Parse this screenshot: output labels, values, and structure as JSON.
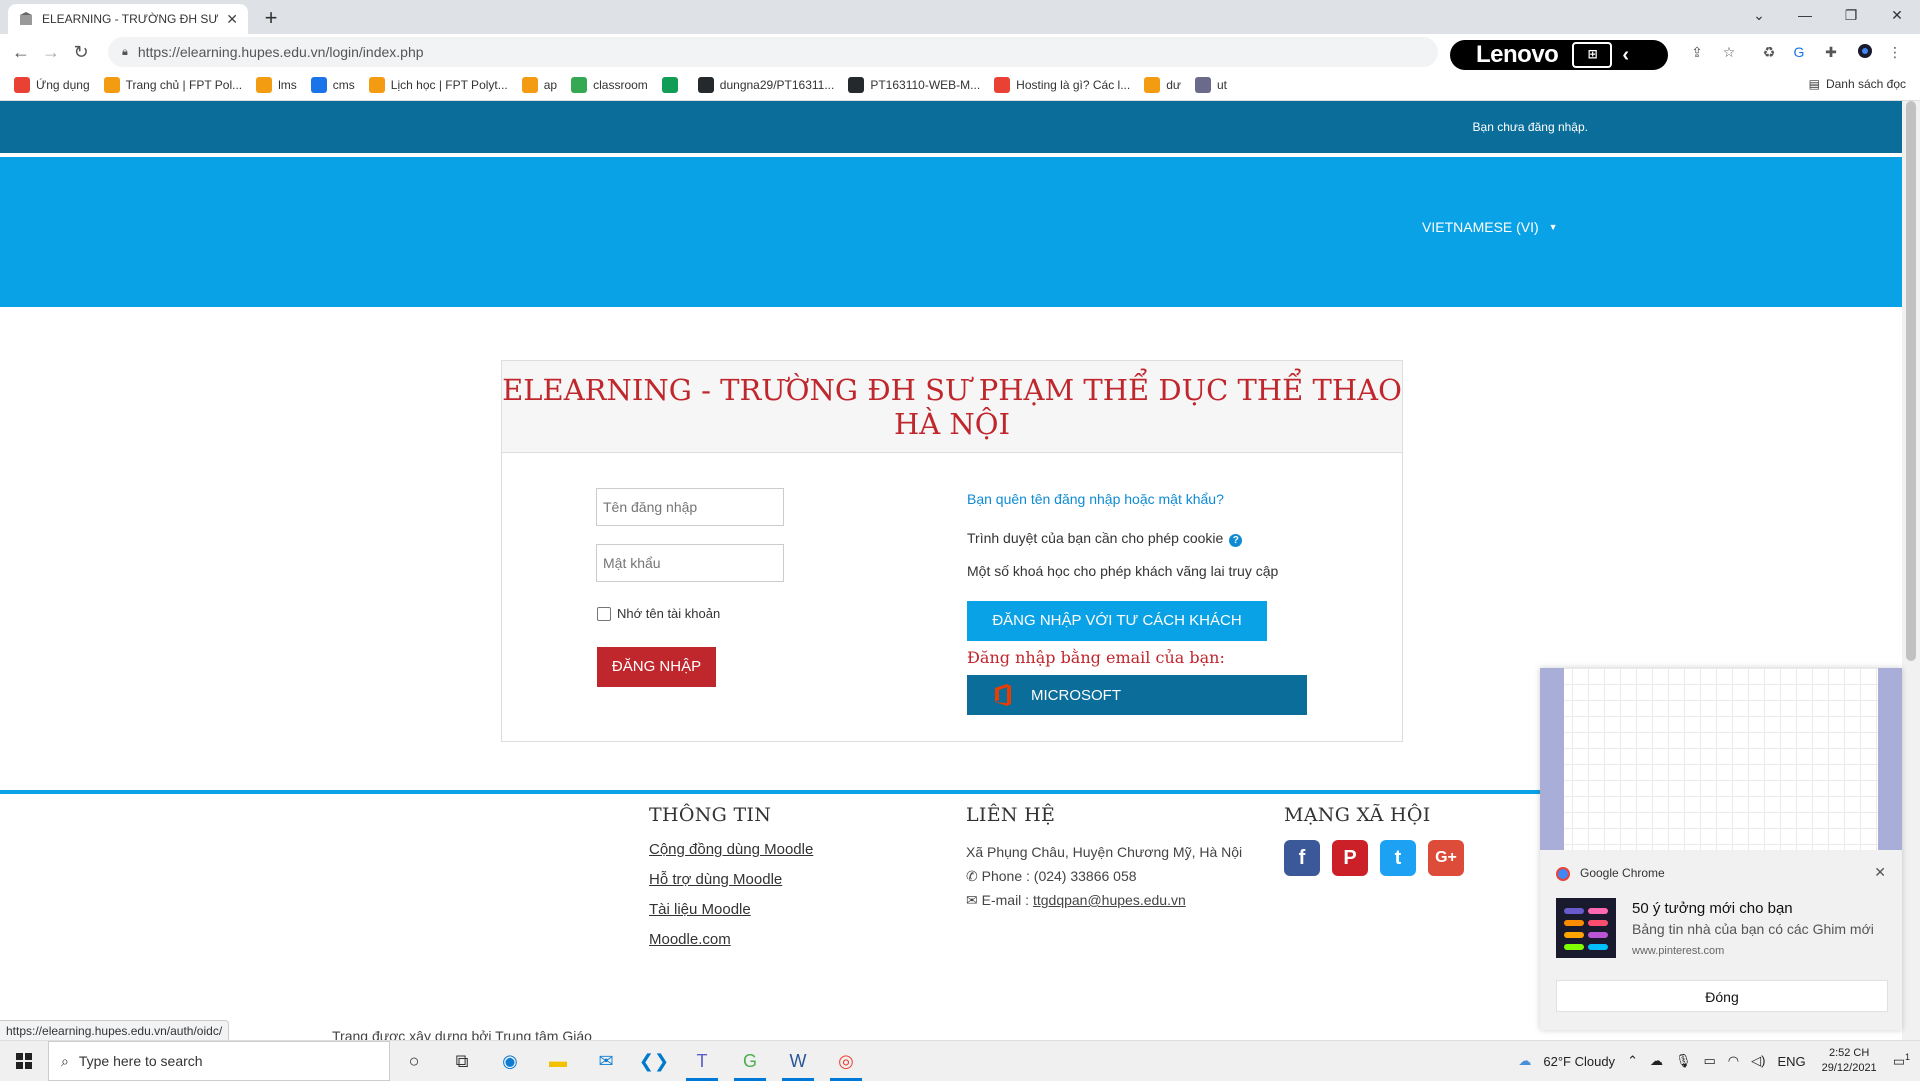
{
  "browser": {
    "tab_title": "ELEARNING - TRƯỜNG ĐH SƯ PHẠM",
    "url": "https://elearning.hupes.edu.vn/login/index.php",
    "lenovo_label": "Lenovo",
    "bookmarks": [
      {
        "label": "Ứng dụng",
        "color": "#e94235"
      },
      {
        "label": "Trang chủ | FPT Pol...",
        "color": "#f39c12"
      },
      {
        "label": "lms",
        "color": "#f39c12"
      },
      {
        "label": "cms",
        "color": "#1a73e8"
      },
      {
        "label": "Lịch học | FPT Polyt...",
        "color": "#f39c12"
      },
      {
        "label": "ap",
        "color": "#f39c12"
      },
      {
        "label": "classroom",
        "color": "#34a853"
      },
      {
        "label": "",
        "color": "#0f9d58"
      },
      {
        "label": "dungna29/PT16311...",
        "color": "#24292e"
      },
      {
        "label": "PT163110-WEB-M...",
        "color": "#24292e"
      },
      {
        "label": "Hosting là gì? Các l...",
        "color": "#e94235"
      },
      {
        "label": "dư",
        "color": "#f39c12"
      },
      {
        "label": "ut",
        "color": "#6a6a8a"
      }
    ],
    "reading_list": "Danh sách đọc",
    "status_url": "https://elearning.hupes.edu.vn/auth/oidc/"
  },
  "page": {
    "login_status": "Bạn chưa đăng nhập.",
    "language": "VIETNAMESE (VI)",
    "site_title_line1": "ELEARNING - TRƯỜNG ĐH SƯ PHẠM THỂ DỤC THỂ THAO",
    "site_title_line2": "HÀ NỘI",
    "login": {
      "username_placeholder": "Tên đăng nhập",
      "password_placeholder": "Mật khẩu",
      "remember_label": "Nhớ tên tài khoản",
      "login_button": "ĐĂNG NHẬP",
      "forgot_link": "Bạn quên tên đăng nhập hoặc mật khẩu?",
      "cookie_text": "Trình duyệt của bạn cần cho phép cookie",
      "guest_text": "Một số khoá học cho phép khách vãng lai truy cập",
      "guest_button": "ĐĂNG NHẬP VỚI TƯ CÁCH KHÁCH",
      "email_login_text": "Đăng nhập bằng email của bạn:",
      "microsoft_button": "MICROSOFT"
    },
    "footer": {
      "info_heading": "THÔNG TIN",
      "info_links": [
        "Cộng đồng dùng Moodle",
        "Hỗ trợ dùng Moodle",
        "Tài liệu Moodle",
        "Moodle.com"
      ],
      "contact_heading": "LIÊN HỆ",
      "address": "Xã Phụng Châu, Huyện Chương Mỹ, Hà Nội",
      "phone": "Phone : (024) 33866 058",
      "email_label": "E-mail : ",
      "email": "ttgdqpan@hupes.edu.vn",
      "social_heading": "MẠNG XÃ HỘI",
      "credit": "Trang được xây dựng bởi Trung tâm Giáo"
    }
  },
  "notification": {
    "app": "Google Chrome",
    "title": "50 ý tưởng mới cho bạn",
    "body": "Bảng tin nhà của bạn có các Ghim mới",
    "site": "www.pinterest.com",
    "button": "Đóng"
  },
  "taskbar": {
    "search_placeholder": "Type here to search",
    "weather": "62°F  Cloudy",
    "lang": "ENG",
    "time": "2:52 CH",
    "date": "29/12/2021",
    "notif_count": "1"
  },
  "colors": {
    "accent_dark": "#0a6d9a",
    "accent_light": "#0aa2e6",
    "brand_red": "#c0272d"
  }
}
